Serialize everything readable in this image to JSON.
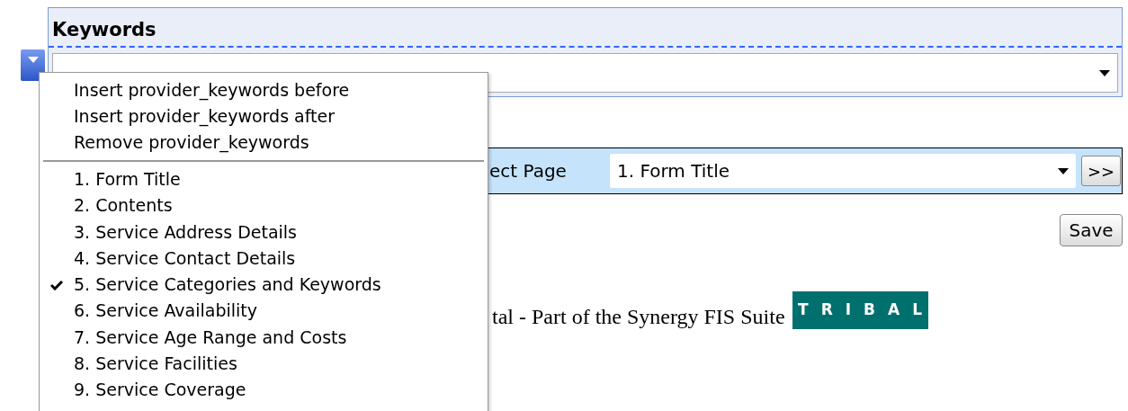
{
  "panel": {
    "title": "Keywords"
  },
  "page_selector": {
    "label": "ect Page",
    "value": "1. Form Title",
    "next_button": ">>"
  },
  "save_button": "Save",
  "footer": {
    "text": "tal - Part of the Synergy FIS Suite",
    "logo": "TRIBAL"
  },
  "menu": {
    "actions": [
      "Insert provider_keywords before",
      "Insert provider_keywords after",
      "Remove provider_keywords"
    ],
    "pages": [
      {
        "label": "1. Form Title",
        "checked": false
      },
      {
        "label": "2. Contents",
        "checked": false
      },
      {
        "label": "3. Service Address Details",
        "checked": false
      },
      {
        "label": "4. Service Contact Details",
        "checked": false
      },
      {
        "label": "5. Service Categories and Keywords",
        "checked": true
      },
      {
        "label": "6. Service Availability",
        "checked": false
      },
      {
        "label": "7. Service Age Range and Costs",
        "checked": false
      },
      {
        "label": "8. Service Facilities",
        "checked": false
      },
      {
        "label": "9. Service Coverage",
        "checked": false
      }
    ]
  }
}
